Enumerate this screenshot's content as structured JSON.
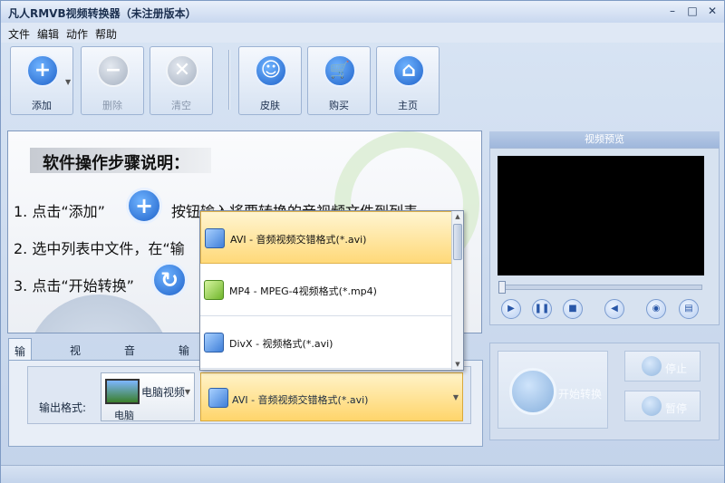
{
  "window": {
    "title": "凡人RMVB视频转换器（未注册版本）",
    "controls": {
      "minimize": "–",
      "maximize": "□",
      "close": "✕"
    }
  },
  "menu": [
    "文件",
    "编辑",
    "动作",
    "帮助"
  ],
  "toolbar": {
    "add": {
      "label": "添加",
      "icon": "plus-icon"
    },
    "delete": {
      "label": "删除",
      "icon": "minus-icon"
    },
    "clear": {
      "label": "清空",
      "icon": "x-icon"
    },
    "skin": {
      "label": "皮肤",
      "icon": "smiley-icon"
    },
    "buy": {
      "label": "购买",
      "icon": "cart-icon"
    },
    "home": {
      "label": "主页",
      "icon": "home-icon"
    }
  },
  "guide": {
    "heading": "软件操作步骤说明：",
    "step1_a": "1. 点击“添加”",
    "step1_b": "按钮输入将要转换的音视频文件到列表",
    "step2": "2. 选中列表中文件，在“输",
    "step3": "3. 点击“开始转换”"
  },
  "tabs": [
    "输出格式",
    "视频参数",
    "音频参数",
    "输出"
  ],
  "output": {
    "label": "输出格式:",
    "device": "电脑视频",
    "device_sub": "电脑",
    "format_selected": "AVI - 音频视频交错格式(*.avi)"
  },
  "format_dropdown": [
    {
      "label": "AVI - 音频视频交错格式(*.avi)",
      "selected": true,
      "icon": "blue-cube-icon"
    },
    {
      "label": "MP4 - MPEG-4视频格式(*.mp4)",
      "selected": false,
      "icon": "green-cube-icon"
    },
    {
      "label": "DivX - 视频格式(*.avi)",
      "selected": false,
      "icon": "blue-cube-icon"
    }
  ],
  "preview": {
    "title": "视频预览"
  },
  "actions": {
    "start": "开始转换",
    "stop": "停止",
    "pause": "暂停"
  },
  "colors": {
    "accent": "#1f62c9",
    "selection": "#ffd979"
  }
}
